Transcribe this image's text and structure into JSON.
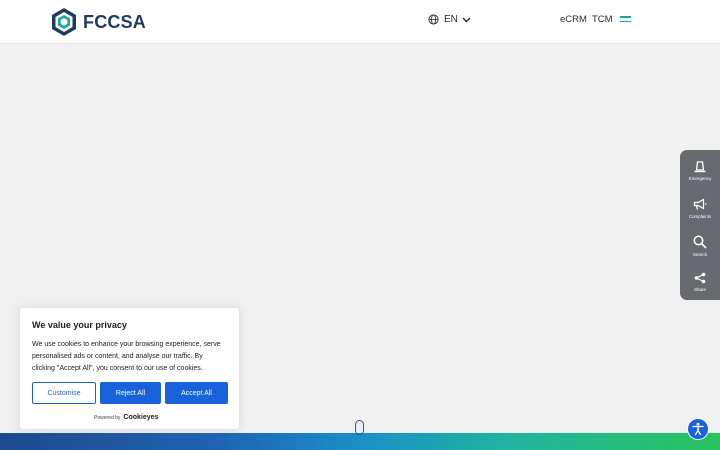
{
  "header": {
    "logo_text": "FCCSA",
    "language": "EN",
    "nav": [
      {
        "label": "eCRM"
      },
      {
        "label": "TCM"
      }
    ]
  },
  "side_panel": {
    "items": [
      {
        "label": "Emergency",
        "icon": "emergency-light-icon"
      },
      {
        "label": "Complaints",
        "icon": "megaphone-icon"
      },
      {
        "label": "Search",
        "icon": "search-icon"
      },
      {
        "label": "Share",
        "icon": "share-icon"
      }
    ]
  },
  "cookie_banner": {
    "title": "We value your privacy",
    "body": "We use cookies to enhance your browsing experience, serve personalised ads or content, and analyse our traffic. By clicking \"Accept All\", you consent to our use of cookies.",
    "customise_label": "Customise",
    "reject_label": "Reject All",
    "accept_label": "Accept All",
    "powered_by": "Powered by",
    "brand": "Cookieyes"
  },
  "colors": {
    "primary": "#1863dc",
    "brand_navy": "#1f3a64",
    "accent_teal": "#1aa8a0",
    "panel_gray": "#676a6f"
  }
}
